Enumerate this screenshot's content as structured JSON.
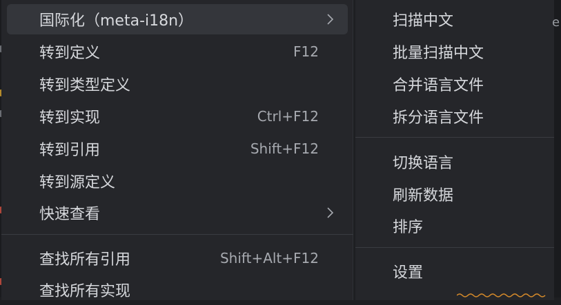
{
  "menu": {
    "items": [
      {
        "label": "国际化（meta-i18n）",
        "shortcut": "",
        "submenu": true,
        "highlighted": true
      },
      {
        "label": "转到定义",
        "shortcut": "F12",
        "submenu": false
      },
      {
        "label": "转到类型定义",
        "shortcut": "",
        "submenu": false
      },
      {
        "label": "转到实现",
        "shortcut": "Ctrl+F12",
        "submenu": false
      },
      {
        "label": "转到引用",
        "shortcut": "Shift+F12",
        "submenu": false
      },
      {
        "label": "转到源定义",
        "shortcut": "",
        "submenu": false
      },
      {
        "label": "快速查看",
        "shortcut": "",
        "submenu": true
      },
      {
        "label": "查找所有引用",
        "shortcut": "Shift+Alt+F12",
        "submenu": false
      },
      {
        "label": "查找所有实现",
        "shortcut": "",
        "submenu": false
      }
    ]
  },
  "submenu": {
    "items": [
      {
        "label": "扫描中文"
      },
      {
        "label": "批量扫描中文"
      },
      {
        "label": "合并语言文件"
      },
      {
        "label": "拆分语言文件"
      },
      {
        "label": "切换语言"
      },
      {
        "label": "刷新数据"
      },
      {
        "label": "排序"
      },
      {
        "label": "设置"
      }
    ]
  },
  "editor_peek": {
    "text": "e"
  },
  "colors": {
    "menu_bg": "#25262a",
    "highlight_bg": "#34363b",
    "separator": "#3a3c41",
    "text": "#d6d8dc",
    "shortcut_text": "#a7aab0",
    "squiggle": "#d58a2a"
  }
}
